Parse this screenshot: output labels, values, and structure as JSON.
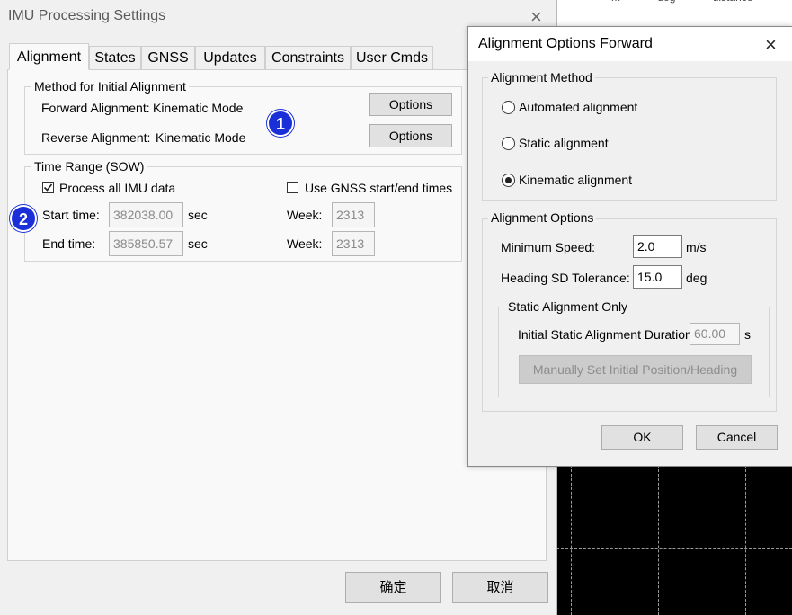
{
  "background": {
    "top_labels": [
      "m",
      "deg",
      "distance"
    ]
  },
  "main_window": {
    "title": "IMU Processing Settings",
    "close_symbol": "×",
    "tabs": [
      "Alignment",
      "States",
      "GNSS",
      "Updates",
      "Constraints",
      "User Cmds"
    ],
    "method_group": {
      "title": "Method for Initial Alignment",
      "forward_label": "Forward Alignment:",
      "forward_value": "Kinematic Mode",
      "reverse_label": "Reverse Alignment:",
      "reverse_value": "Kinematic Mode",
      "options_label": "Options"
    },
    "time_group": {
      "title": "Time Range (SOW)",
      "process_all_label": "Process all IMU data",
      "process_all_checked": true,
      "use_gnss_label": "Use GNSS start/end times",
      "use_gnss_checked": false,
      "start_label": "Start time:",
      "start_value": "382038.00",
      "end_label": "End time:",
      "end_value": "385850.57",
      "unit": "sec",
      "week_label": "Week:",
      "start_week": "2313",
      "end_week": "2313"
    },
    "badges": [
      "1",
      "2"
    ],
    "ok_label": "确定",
    "cancel_label": "取消"
  },
  "dialog": {
    "title": "Alignment Options Forward",
    "close_symbol": "×",
    "method_group": {
      "title": "Alignment Method",
      "options": [
        {
          "label": "Automated alignment",
          "checked": false
        },
        {
          "label": "Static alignment",
          "checked": false
        },
        {
          "label": "Kinematic alignment",
          "checked": true
        }
      ]
    },
    "options_group": {
      "title": "Alignment Options",
      "min_speed_label": "Minimum Speed:",
      "min_speed_value": "2.0",
      "min_speed_unit": "m/s",
      "heading_label": "Heading SD Tolerance:",
      "heading_value": "15.0",
      "heading_unit": "deg",
      "static_group": {
        "title": "Static Alignment Only",
        "duration_label": "Initial Static Alignment Duration:",
        "duration_value": "60.00",
        "duration_unit": "s",
        "manual_button": "Manually Set Initial Position/Heading"
      }
    },
    "ok_label": "OK",
    "cancel_label": "Cancel"
  }
}
